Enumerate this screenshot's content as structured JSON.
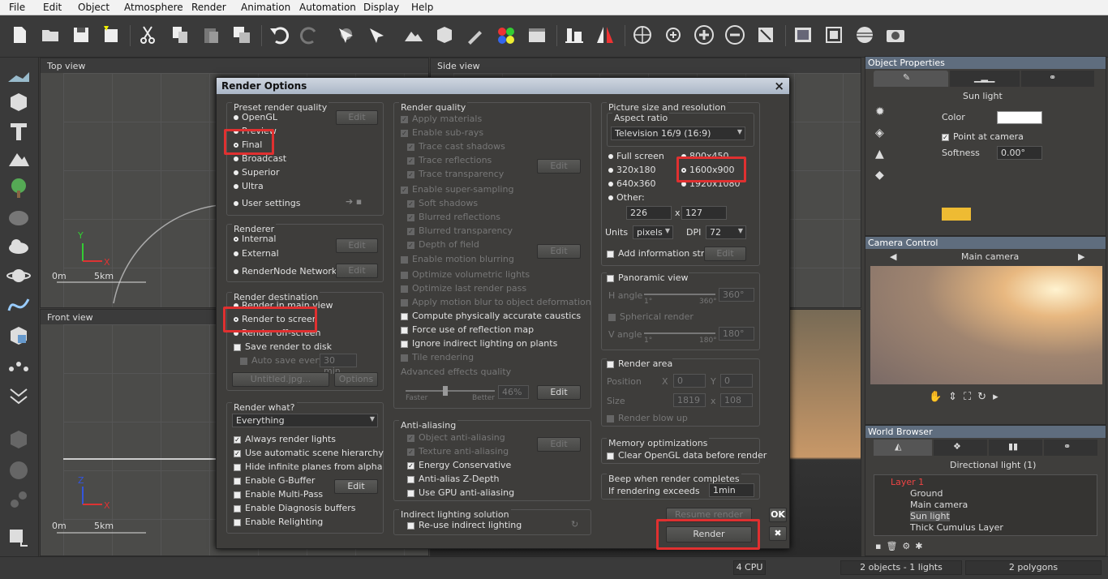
{
  "menu": [
    "File",
    "Edit",
    "Object",
    "Atmosphere",
    "Render",
    "Animation",
    "Automation",
    "Display",
    "Help"
  ],
  "viewports": {
    "top": "Top view",
    "side": "Side view",
    "front": "Front view",
    "scale_0": "0m",
    "scale_5": "5km",
    "axis_y": "Y",
    "axis_x": "X",
    "axis_z": "Z"
  },
  "object_properties": {
    "title": "Object Properties",
    "name": "Sun light",
    "color_label": "Color",
    "point_at_camera": "Point at camera",
    "softness_label": "Softness",
    "softness_value": "0.00°"
  },
  "camera_control": {
    "title": "Camera Control",
    "camera": "Main camera"
  },
  "world_browser": {
    "title": "World Browser",
    "subtitle": "Directional light (1)",
    "items": [
      "Layer 1",
      "Ground",
      "Main camera",
      "Sun light",
      "Thick Cumulus Layer"
    ]
  },
  "status": {
    "cpu": "4 CPU",
    "objects": "2 objects - 1 lights",
    "polygons": "2 polygons"
  },
  "dialog": {
    "title": "Render Options",
    "close": "×",
    "preset": {
      "title": "Preset render quality",
      "opengl": "OpenGL",
      "preview": "Preview",
      "final": "Final",
      "broadcast": "Broadcast",
      "superior": "Superior",
      "ultra": "Ultra",
      "user": "User settings",
      "edit": "Edit"
    },
    "renderer": {
      "title": "Renderer",
      "internal": "Internal",
      "external": "External",
      "network": "RenderNode Network",
      "edit": "Edit"
    },
    "destination": {
      "title": "Render destination",
      "main_view": "Render in main view",
      "screen": "Render to screen",
      "off_screen": "Render off-screen",
      "save_disk": "Save render to disk",
      "auto_save": "Auto save every",
      "auto_value": "30 min",
      "file": "Untitled.jpg...",
      "options": "Options"
    },
    "what": {
      "title": "Render what?",
      "value": "Everything",
      "always_lights": "Always render lights",
      "auto_hier": "Use automatic scene hierarchy",
      "hide_planes": "Hide infinite planes from alpha",
      "gbuffer": "Enable G-Buffer",
      "multipass": "Enable Multi-Pass",
      "diag": "Enable Diagnosis buffers",
      "relight": "Enable Relighting",
      "edit": "Edit"
    },
    "quality": {
      "title": "Render quality",
      "apply_mat": "Apply materials",
      "subrays": "Enable sub-rays",
      "cast_shadows": "Trace cast shadows",
      "reflections": "Trace reflections",
      "transparency": "Trace transparency",
      "supersampling": "Enable super-sampling",
      "soft_shadows": "Soft shadows",
      "blur_refl": "Blurred reflections",
      "blur_transp": "Blurred transparency",
      "dof": "Depth of field",
      "motion_blur": "Enable motion blurring",
      "opt_vol": "Optimize volumetric lights",
      "opt_last": "Optimize last render pass",
      "motion_deform": "Apply motion blur to object deformation",
      "caustics": "Compute physically accurate caustics",
      "force_refl": "Force use of reflection map",
      "ignore_plants": "Ignore indirect lighting on plants",
      "tile": "Tile rendering",
      "adv": "Advanced effects quality",
      "faster": "Faster",
      "better": "Better",
      "pct": "46%",
      "edit": "Edit"
    },
    "antialias": {
      "title": "Anti-aliasing",
      "object": "Object anti-aliasing",
      "texture": "Texture anti-aliasing",
      "energy": "Energy Conservative",
      "zdepth": "Anti-alias Z-Depth",
      "gpu": "Use GPU anti-aliasing",
      "edit": "Edit"
    },
    "indirect": {
      "title": "Indirect lighting solution",
      "reuse": "Re-use indirect lighting"
    },
    "picture": {
      "title": "Picture size and resolution",
      "aspect": "Aspect ratio",
      "aspect_value": "Television 16/9 (16:9)",
      "full": "Full screen",
      "r800": "800x450",
      "r320": "320x180",
      "r1600": "1600x900",
      "r640": "640x360",
      "r1920": "1920x1080",
      "other": "Other:",
      "w": "226",
      "x": "x",
      "h": "127",
      "units": "Units",
      "units_value": "pixels",
      "dpi": "DPI",
      "dpi_value": "72",
      "info_strip": "Add information strip",
      "edit": "Edit"
    },
    "panoramic": {
      "title": "Panoramic view",
      "h_angle": "H angle",
      "h_val": "360°",
      "spherical": "Spherical render",
      "v_angle": "V angle",
      "v_val": "180°",
      "min": "1°",
      "hmax": "360°",
      "vmax": "180°"
    },
    "area": {
      "title": "Render area",
      "position": "Position",
      "size": "Size",
      "x": "X",
      "y": "Y",
      "px": "0",
      "py": "0",
      "sx": "1819",
      "sy": "108",
      "blowup": "Render blow up"
    },
    "memory": {
      "title": "Memory optimizations",
      "clear": "Clear OpenGL data before render"
    },
    "beep": {
      "title": "Beep when render completes",
      "exceeds": "If rendering exceeds",
      "value": "1min"
    },
    "resume": "Resume render",
    "render": "Render",
    "ok": "OK",
    "cancel": "✖"
  }
}
